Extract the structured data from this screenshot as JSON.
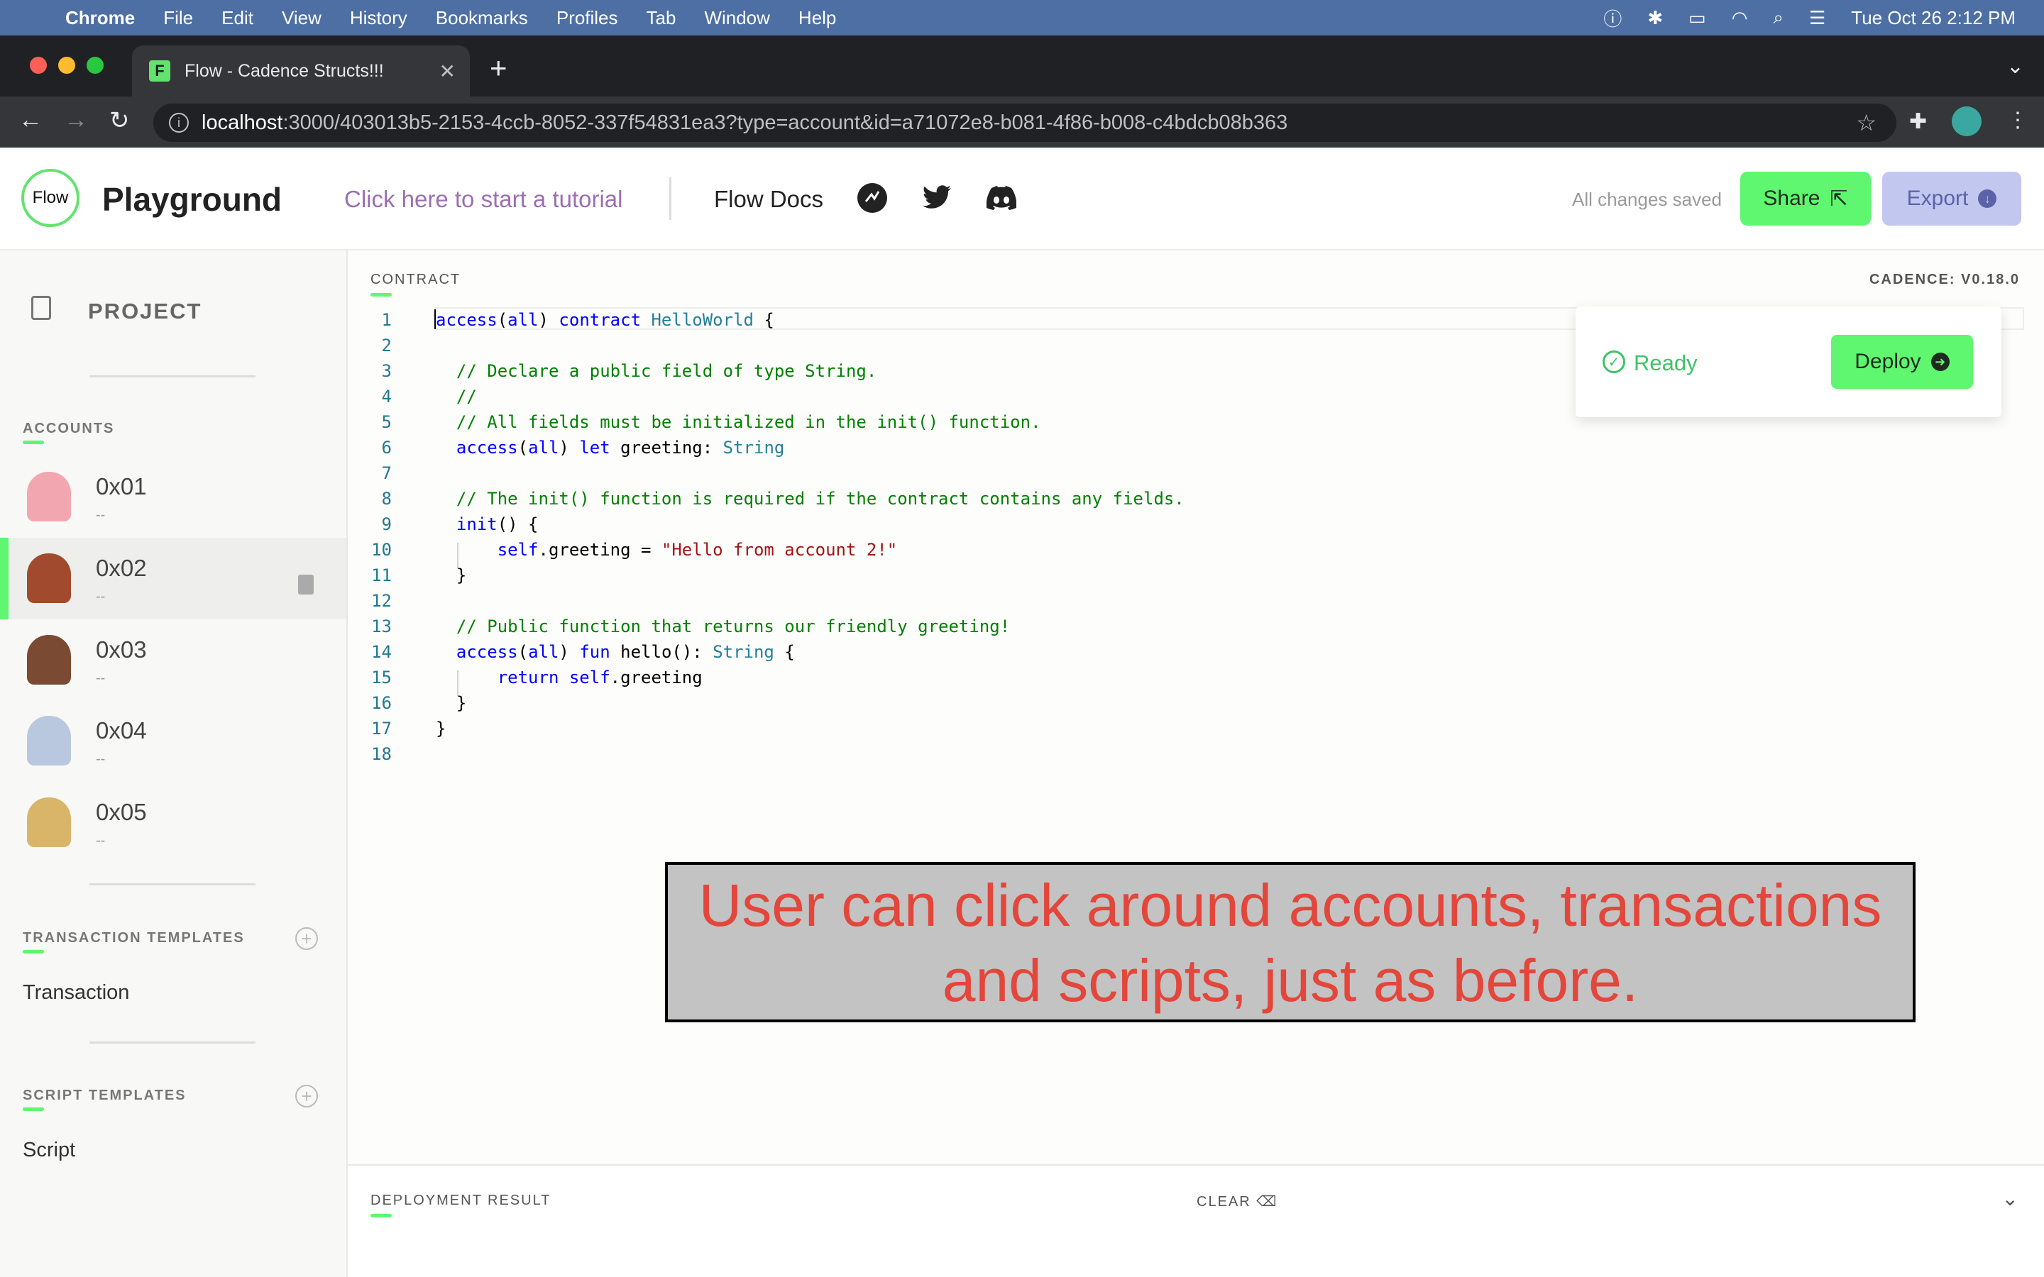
{
  "menubar": {
    "app": "Chrome",
    "items": [
      "File",
      "Edit",
      "View",
      "History",
      "Bookmarks",
      "Profiles",
      "Tab",
      "Window",
      "Help"
    ],
    "clock": "Tue Oct 26  2:12 PM"
  },
  "browser": {
    "tab_title": "Flow - Cadence Structs!!!",
    "tab_favicon": "F",
    "url_host": "localhost",
    "url_rest": ":3000/403013b5-2153-4ccb-8052-337f54831ea3?type=account&id=a71072e8-b081-4f86-b008-c4bdcb08b363"
  },
  "header": {
    "logo": "Flow",
    "title": "Playground",
    "tutorial_link": "Click here to start a tutorial",
    "docs_link": "Flow Docs",
    "status": "All changes saved",
    "share_label": "Share",
    "export_label": "Export"
  },
  "sidebar": {
    "project_label": "PROJECT",
    "accounts_label": "ACCOUNTS",
    "accounts": [
      {
        "name": "0x01",
        "balance": "--",
        "selected": false
      },
      {
        "name": "0x02",
        "balance": "--",
        "selected": true
      },
      {
        "name": "0x03",
        "balance": "--",
        "selected": false
      },
      {
        "name": "0x04",
        "balance": "--",
        "selected": false
      },
      {
        "name": "0x05",
        "balance": "--",
        "selected": false
      }
    ],
    "transaction_templates_label": "TRANSACTION TEMPLATES",
    "transaction_item": "Transaction",
    "script_templates_label": "SCRIPT TEMPLATES",
    "script_item": "Script"
  },
  "editor": {
    "section_label": "CONTRACT",
    "version_label": "CADENCE: V0.18.0",
    "line_numbers": [
      "1",
      "2",
      "3",
      "4",
      "5",
      "6",
      "7",
      "8",
      "9",
      "10",
      "11",
      "12",
      "13",
      "14",
      "15",
      "16",
      "17",
      "18"
    ],
    "lines": [
      "access(all) contract HelloWorld {",
      "",
      "  // Declare a public field of type String.",
      "  //",
      "  // All fields must be initialized in the init() function.",
      "  access(all) let greeting: String",
      "",
      "  // The init() function is required if the contract contains any fields.",
      "  init() {",
      "      self.greeting = \"Hello from account 2!\"",
      "  }",
      "",
      "  // Public function that returns our friendly greeting!",
      "  access(all) fun hello(): String {",
      "      return self.greeting",
      "  }",
      "}",
      ""
    ]
  },
  "deploy_panel": {
    "status": "Ready",
    "deploy_label": "Deploy"
  },
  "caption": {
    "line1": "User can click around accounts, transactions",
    "line2": "and scripts, just as before."
  },
  "bottom_panel": {
    "label": "DEPLOYMENT RESULT",
    "clear_label": "CLEAR"
  },
  "colors": {
    "accent": "#5ef76f",
    "menubar": "#4d6fa3",
    "caption_text": "#e3463b"
  }
}
